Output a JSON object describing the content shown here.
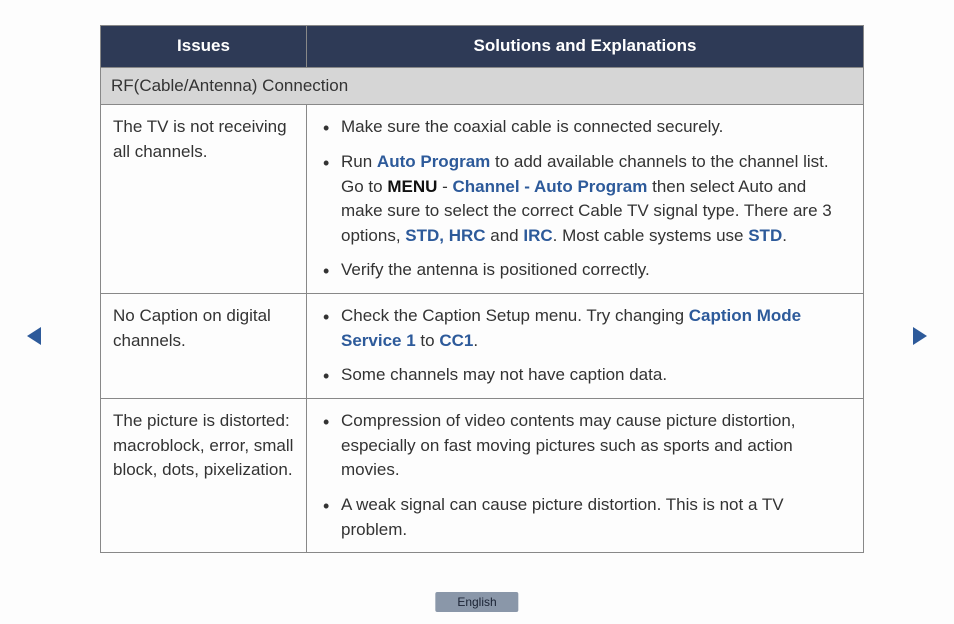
{
  "table": {
    "headers": {
      "issues": "Issues",
      "solutions": "Solutions and Explanations"
    },
    "section": "RF(Cable/Antenna) Connection",
    "rows": [
      {
        "issue": "The TV is not receiving all channels.",
        "bullets": [
          {
            "pre": "Make sure the coaxial cable is connected securely."
          },
          {
            "pre": "Run ",
            "hl1": "Auto Program",
            "mid1": " to add available channels to the channel list. Go to ",
            "bold1": "MENU",
            "mid1b": " - ",
            "hl2": "Channel - Auto Program",
            "mid2": " then select Auto and make sure to select the correct Cable TV signal type. There are 3 options, ",
            "hl3": "STD, HRC",
            "mid3": " and ",
            "hl4": "IRC",
            "mid4": ". Most cable systems use ",
            "hl5": "STD",
            "post": "."
          },
          {
            "pre": "Verify the antenna is positioned correctly."
          }
        ]
      },
      {
        "issue": "No Caption on digital channels.",
        "bullets": [
          {
            "pre": "Check the Caption Setup menu. Try changing ",
            "hl1": "Caption Mode Service 1",
            "mid1": " to ",
            "hl2": "CC1",
            "post": "."
          },
          {
            "pre": "Some channels may not have caption data."
          }
        ]
      },
      {
        "issue": "The picture is distorted: macroblock, error, small block, dots, pixelization.",
        "bullets": [
          {
            "pre": "Compression of video contents may cause picture distortion, especially on fast moving pictures such as sports and action movies."
          },
          {
            "pre": "A weak signal can cause picture distortion. This is not a TV problem."
          }
        ]
      }
    ]
  },
  "language": "English",
  "colors": {
    "header_bg": "#2e3a56",
    "highlight": "#2d5a9a",
    "arrow": "#2d5a9a"
  }
}
